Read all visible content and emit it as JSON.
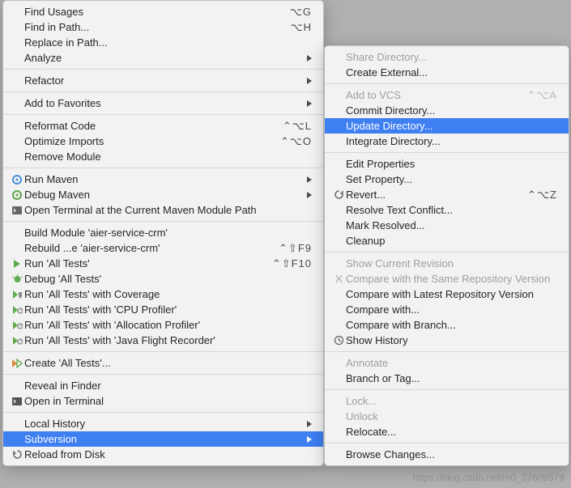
{
  "left": {
    "g1": [
      {
        "label": "Find Usages",
        "shortcut": "⌥G"
      },
      {
        "label": "Find in Path...",
        "shortcut": "⌥H"
      },
      {
        "label": "Replace in Path..."
      },
      {
        "label": "Analyze",
        "submenu": true
      }
    ],
    "g2": [
      {
        "label": "Refactor",
        "submenu": true
      }
    ],
    "g3": [
      {
        "label": "Add to Favorites",
        "submenu": true
      }
    ],
    "g4": [
      {
        "label": "Reformat Code",
        "shortcut": "⌃⌥L"
      },
      {
        "label": "Optimize Imports",
        "shortcut": "⌃⌥O"
      },
      {
        "label": "Remove Module"
      }
    ],
    "g5": [
      {
        "label": "Run Maven",
        "submenu": true,
        "icon": "gear-blue"
      },
      {
        "label": "Debug Maven",
        "submenu": true,
        "icon": "gear-green"
      },
      {
        "label": "Open Terminal at the Current Maven Module Path",
        "icon": "terminal"
      }
    ],
    "g6": [
      {
        "label": "Build Module 'aier-service-crm'"
      },
      {
        "label": "Rebuild ...e 'aier-service-crm'",
        "shortcut": "⌃⇧F9"
      },
      {
        "label": "Run 'All Tests'",
        "shortcut": "⌃⇧F10",
        "icon": "play"
      },
      {
        "label": "Debug 'All Tests'",
        "icon": "bug"
      },
      {
        "label": "Run 'All Tests' with Coverage",
        "icon": "play-shield"
      },
      {
        "label": "Run 'All Tests' with 'CPU Profiler'",
        "icon": "play-meter"
      },
      {
        "label": "Run 'All Tests' with 'Allocation Profiler'",
        "icon": "play-meter"
      },
      {
        "label": "Run 'All Tests' with 'Java Flight Recorder'",
        "icon": "play-meter"
      }
    ],
    "g7": [
      {
        "label": "Create 'All Tests'...",
        "icon": "play-outline"
      }
    ],
    "g8": [
      {
        "label": "Reveal in Finder"
      },
      {
        "label": "Open in Terminal",
        "icon": "terminal-dark"
      }
    ],
    "g9": [
      {
        "label": "Local History",
        "submenu": true
      },
      {
        "label": "Subversion",
        "submenu": true,
        "highlighted": true
      },
      {
        "label": "Reload from Disk",
        "icon": "reload"
      }
    ]
  },
  "right": {
    "g1": [
      {
        "label": "Share Directory...",
        "disabled": true
      },
      {
        "label": "Create External..."
      }
    ],
    "g2": [
      {
        "label": "Add to VCS",
        "shortcut": "⌃⌥A",
        "disabled": true
      },
      {
        "label": "Commit Directory..."
      },
      {
        "label": "Update Directory...",
        "highlighted": true
      },
      {
        "label": "Integrate Directory..."
      }
    ],
    "g3": [
      {
        "label": "Edit Properties"
      },
      {
        "label": "Set Property..."
      },
      {
        "label": "Revert...",
        "shortcut": "⌃⌥Z",
        "icon": "revert"
      },
      {
        "label": "Resolve Text Conflict..."
      },
      {
        "label": "Mark Resolved..."
      },
      {
        "label": "Cleanup"
      }
    ],
    "g4": [
      {
        "label": "Show Current Revision",
        "disabled": true
      },
      {
        "label": "Compare with the Same Repository Version",
        "disabled": true,
        "icon": "diff"
      },
      {
        "label": "Compare with Latest Repository Version"
      },
      {
        "label": "Compare with..."
      },
      {
        "label": "Compare with Branch..."
      },
      {
        "label": "Show History",
        "icon": "clock"
      }
    ],
    "g5": [
      {
        "label": "Annotate",
        "disabled": true
      },
      {
        "label": "Branch or Tag..."
      }
    ],
    "g6": [
      {
        "label": "Lock...",
        "disabled": true
      },
      {
        "label": "Unlock",
        "disabled": true
      },
      {
        "label": "Relocate..."
      }
    ],
    "g7": [
      {
        "label": "Browse Changes..."
      }
    ]
  },
  "watermark": "https://blog.csdn.net/m0_37609579"
}
